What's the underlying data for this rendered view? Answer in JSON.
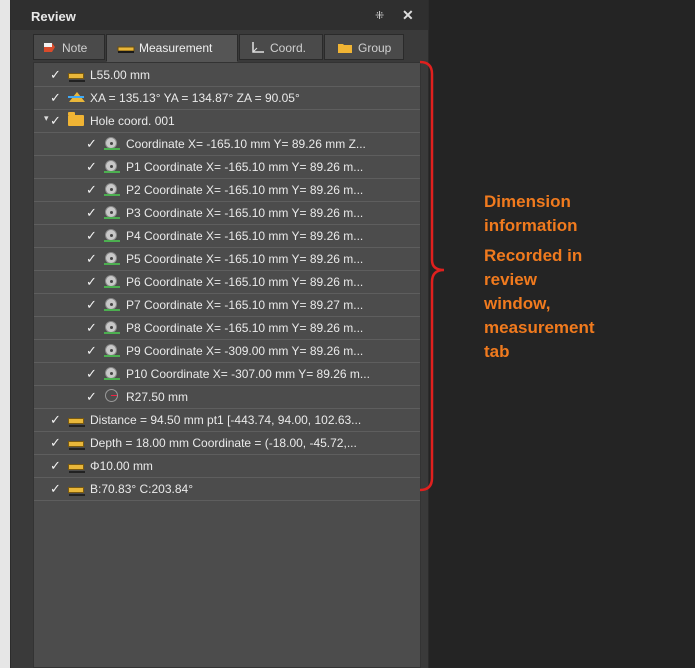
{
  "panel": {
    "title": "Review",
    "pin_glyph": "⁜",
    "close_glyph": "✕"
  },
  "tabs": [
    {
      "label": "Note",
      "icon": "note-icon",
      "active": false
    },
    {
      "label": "Measurement",
      "icon": "ruler-icon",
      "active": true
    },
    {
      "label": "Coord.",
      "icon": "coord-axis-icon",
      "active": false
    },
    {
      "label": "Group",
      "icon": "folder-icon",
      "active": false
    }
  ],
  "tree": {
    "rows": [
      {
        "text": "L55.00 mm",
        "icon": "ruler-icon",
        "level": 1,
        "checked": true
      },
      {
        "text": "XA = 135.13° YA = 134.87° ZA = 90.05°",
        "icon": "angle-icon",
        "level": 1,
        "checked": true
      },
      {
        "text": "Hole coord. 001",
        "icon": "folder-icon",
        "level": 1,
        "checked": true,
        "expanded": true
      },
      {
        "text": "Coordinate  X= -165.10 mm  Y= 89.26 mm  Z...",
        "icon": "coordinate-icon",
        "level": 2,
        "checked": true
      },
      {
        "text": "P1 Coordinate  X= -165.10 mm  Y= 89.26 m...",
        "icon": "coordinate-icon",
        "level": 2,
        "checked": true
      },
      {
        "text": "P2 Coordinate  X= -165.10 mm  Y= 89.26 m...",
        "icon": "coordinate-icon",
        "level": 2,
        "checked": true
      },
      {
        "text": "P3 Coordinate  X= -165.10 mm  Y= 89.26 m...",
        "icon": "coordinate-icon",
        "level": 2,
        "checked": true
      },
      {
        "text": "P4 Coordinate  X= -165.10 mm  Y= 89.26 m...",
        "icon": "coordinate-icon",
        "level": 2,
        "checked": true
      },
      {
        "text": "P5 Coordinate  X= -165.10 mm  Y= 89.26 m...",
        "icon": "coordinate-icon",
        "level": 2,
        "checked": true
      },
      {
        "text": "P6 Coordinate  X= -165.10 mm  Y= 89.26 m...",
        "icon": "coordinate-icon",
        "level": 2,
        "checked": true
      },
      {
        "text": "P7 Coordinate  X= -165.10 mm  Y= 89.27 m...",
        "icon": "coordinate-icon",
        "level": 2,
        "checked": true
      },
      {
        "text": "P8 Coordinate  X= -165.10 mm  Y= 89.26 m...",
        "icon": "coordinate-icon",
        "level": 2,
        "checked": true
      },
      {
        "text": "P9 Coordinate  X= -309.00 mm  Y= 89.26 m...",
        "icon": "coordinate-icon",
        "level": 2,
        "checked": true
      },
      {
        "text": "P10 Coordinate  X= -307.00 mm  Y= 89.26 m...",
        "icon": "coordinate-icon",
        "level": 2,
        "checked": true
      },
      {
        "text": "R27.50 mm",
        "icon": "radius-icon",
        "level": 2,
        "checked": true
      },
      {
        "text": "Distance = 94.50 mm  pt1 [-443.74, 94.00, 102.63...",
        "icon": "ruler-icon",
        "level": 1,
        "checked": true
      },
      {
        "text": "Depth = 18.00 mm  Coordinate = (-18.00, -45.72,...",
        "icon": "ruler-icon",
        "level": 1,
        "checked": true
      },
      {
        "text": "Φ10.00 mm",
        "icon": "ruler-icon",
        "level": 1,
        "checked": true
      },
      {
        "text": "B:70.83° C:203.84°",
        "icon": "ruler-icon",
        "level": 1,
        "checked": true
      }
    ]
  },
  "annotation": {
    "line1": "Dimension",
    "line2": "information",
    "line3": "Recorded in",
    "line4": "review",
    "line5": "window,",
    "line6": "measurement",
    "line7": "tab",
    "color": "#f07a1e",
    "brace_color": "#e0201e"
  }
}
